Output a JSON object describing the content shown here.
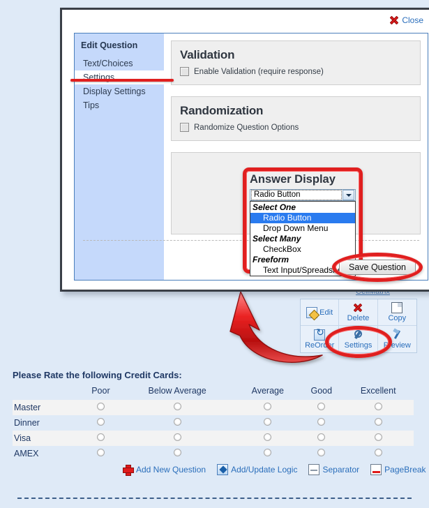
{
  "dialog": {
    "close_label": "Close",
    "sidebar": {
      "title": "Edit Question",
      "items": [
        {
          "label": "Text/Choices"
        },
        {
          "label": "Settings"
        },
        {
          "label": "Display Settings"
        },
        {
          "label": "Tips"
        }
      ],
      "active_index": 1
    },
    "validation": {
      "heading": "Validation",
      "checkbox_label": "Enable Validation (require response)",
      "checked": false
    },
    "randomization": {
      "heading": "Randomization",
      "checkbox_label": "Randomize Question Options",
      "checked": false
    },
    "answer_display": {
      "heading": "Answer Display",
      "selected_value": "Radio Button",
      "groups": [
        {
          "group_label": "Select One",
          "options": [
            "Radio Button",
            "Drop Down Menu"
          ]
        },
        {
          "group_label": "Select Many",
          "options": [
            "CheckBox"
          ]
        },
        {
          "group_label": "Freeform",
          "options": [
            "Text Input/Spreadsheet"
          ]
        }
      ],
      "highlighted_option": "Radio Button"
    },
    "save_label": "Save Question"
  },
  "page": {
    "behind_link": "CellMatrix",
    "toolbar": [
      {
        "label": "Edit",
        "icon": "edit-icon"
      },
      {
        "label": "Delete",
        "icon": "delete-icon"
      },
      {
        "label": "Copy",
        "icon": "copy-icon"
      },
      {
        "label": "ReOrder",
        "icon": "reorder-icon"
      },
      {
        "label": "Settings",
        "icon": "settings-icon"
      },
      {
        "label": "Preview",
        "icon": "preview-icon"
      }
    ],
    "matrix": {
      "title": "Please Rate the following Credit Cards:",
      "columns": [
        "Poor",
        "Below Average",
        "Average",
        "Good",
        "Excellent"
      ],
      "rows": [
        "Master",
        "Dinner",
        "Visa",
        "AMEX"
      ]
    },
    "bottom_actions": [
      {
        "label": "Add New Question",
        "icon": "plus-icon"
      },
      {
        "label": "Add/Update Logic",
        "icon": "logic-icon"
      },
      {
        "label": "Separator",
        "icon": "separator-icon"
      },
      {
        "label": "PageBreak",
        "icon": "pagebreak-icon"
      }
    ]
  },
  "colors": {
    "annotation_red": "#e01f1f",
    "page_background": "#dfeaf7",
    "sidebar_blue": "#c5d9fb",
    "link_blue": "#2a6ebb",
    "highlight_blue": "#2a7bef"
  }
}
